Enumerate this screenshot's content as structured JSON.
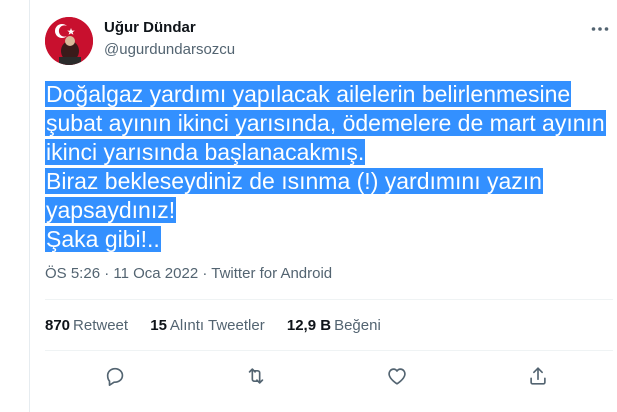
{
  "author": {
    "name": "Uğur Dündar",
    "handle": "@ugurdundarsozcu",
    "avatar_icon": "turkish-flag-avatar"
  },
  "more_icon": "more-horizontal-icon",
  "tweet": {
    "lines": [
      "Doğalgaz yardımı yapılacak ailelerin belirlenmesine",
      "şubat ayının ikinci yarısında, ödemelere de mart ayının",
      "ikinci yarısında başlanacakmış.",
      "Biraz bekleseydiniz de ısınma (!) yardımını yazın",
      "yapsaydınız!",
      "Şaka gibi!.."
    ],
    "selection_color": "#3390ff"
  },
  "meta": {
    "time": "ÖS 5:26",
    "date": "11 Oca 2022",
    "separator": "·",
    "source": "Twitter for Android"
  },
  "stats": [
    {
      "count": "870",
      "label": "Retweet"
    },
    {
      "count": "15",
      "label": "Alıntı Tweetler"
    },
    {
      "count": "12,9 B",
      "label": "Beğeni"
    }
  ],
  "actions": [
    {
      "name": "reply",
      "icon": "reply-icon"
    },
    {
      "name": "retweet",
      "icon": "retweet-icon"
    },
    {
      "name": "like",
      "icon": "heart-icon"
    },
    {
      "name": "share",
      "icon": "share-icon"
    }
  ],
  "colors": {
    "text": "#0f1419",
    "secondary": "#536471",
    "divider": "#eff3f4",
    "avatar_red": "#c8102e"
  }
}
